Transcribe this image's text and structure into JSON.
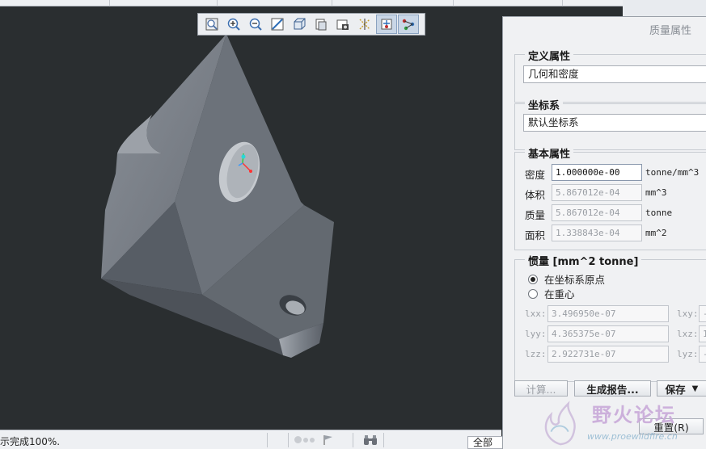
{
  "panel": {
    "title": "质量属性",
    "definition": {
      "label": "定义属性",
      "value": "几何和密度"
    },
    "csys": {
      "label": "坐标系",
      "value": "默认坐标系"
    },
    "basic": {
      "label": "基本属性",
      "rows": [
        {
          "label": "密度",
          "value": "1.000000e-00",
          "unit": "tonne/mm^3"
        },
        {
          "label": "体积",
          "value": "5.867012e-04",
          "unit": "mm^3"
        },
        {
          "label": "质量",
          "value": "5.867012e-04",
          "unit": "tonne"
        },
        {
          "label": "面积",
          "value": "1.338843e-04",
          "unit": "mm^2"
        }
      ]
    },
    "inertia": {
      "label": "惯量 [mm^2 tonne]",
      "options": [
        "在坐标系原点",
        "在重心"
      ],
      "selected": 0,
      "lxx_label": "lxx:",
      "lxx_value": "3.496950e-07",
      "lyy_label": "lyy:",
      "lyy_value": "4.365375e-07",
      "lzz_label": "lzz:",
      "lzz_value": "2.922731e-07",
      "lxy_label": "lxy:",
      "lxy_value": "-",
      "lxz_label": "lxz:",
      "lxz_value": "1",
      "lyz_label": "lyz:",
      "lyz_value": "-"
    },
    "buttons": {
      "calculate": "计算...",
      "report": "生成报告...",
      "save": "保存",
      "reset": "重置(R)"
    }
  },
  "status": {
    "text": "示完成100%.",
    "filter": "全部"
  },
  "toolbar": {
    "icons": [
      "refit-icon",
      "zoom-in-icon",
      "zoom-out-icon",
      "repaint-icon",
      "display-style-icon",
      "saved-orientations-icon",
      "view-manager-icon",
      "datum-display-icon",
      "spin-center-icon",
      "annotation-display-icon"
    ]
  },
  "watermark": {
    "text": "野火论坛",
    "url": "www.proewildfire.cn"
  },
  "colors": {
    "viewport_bg": "#2a2e30",
    "part": "#7b8189",
    "panel_bg": "#f0f1f3"
  }
}
